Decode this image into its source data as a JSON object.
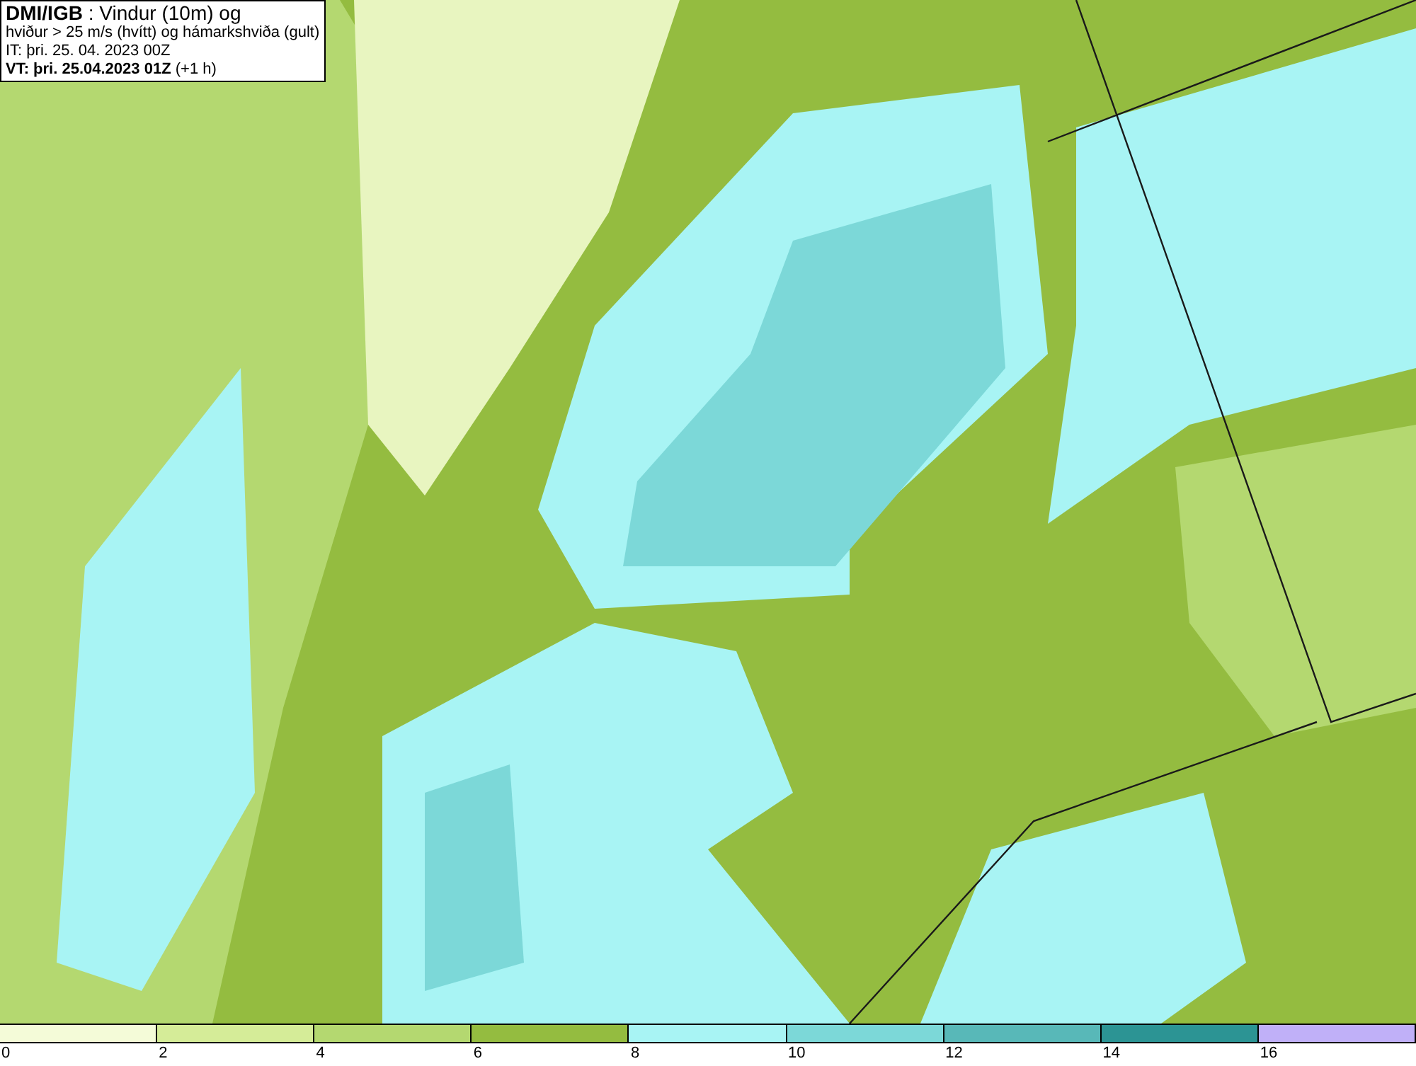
{
  "header": {
    "lines": [
      "**DMI/IGB** : Vindur (10m) og",
      "hviður > 25 m/s (hvítt) og hámarkshviða (gult)",
      "IT: þri. 25. 04. 2023 00Z",
      "**VT: þri. 25.04.2023 01Z** (+1 h)"
    ]
  },
  "legend": {
    "bins": [
      {
        "label": "0",
        "color": "#f4fbd8"
      },
      {
        "label": "2",
        "color": "#d5ec98"
      },
      {
        "label": "4",
        "color": "#b4d870"
      },
      {
        "label": "6",
        "color": "#94bc40"
      },
      {
        "label": "8",
        "color": "#a8f4f4"
      },
      {
        "label": "10",
        "color": "#7cd8d8"
      },
      {
        "label": "12",
        "color": "#58b8b8"
      },
      {
        "label": "14",
        "color": "#2c9494"
      },
      {
        "label": "16",
        "color": "#c0b0f8"
      }
    ]
  }
}
